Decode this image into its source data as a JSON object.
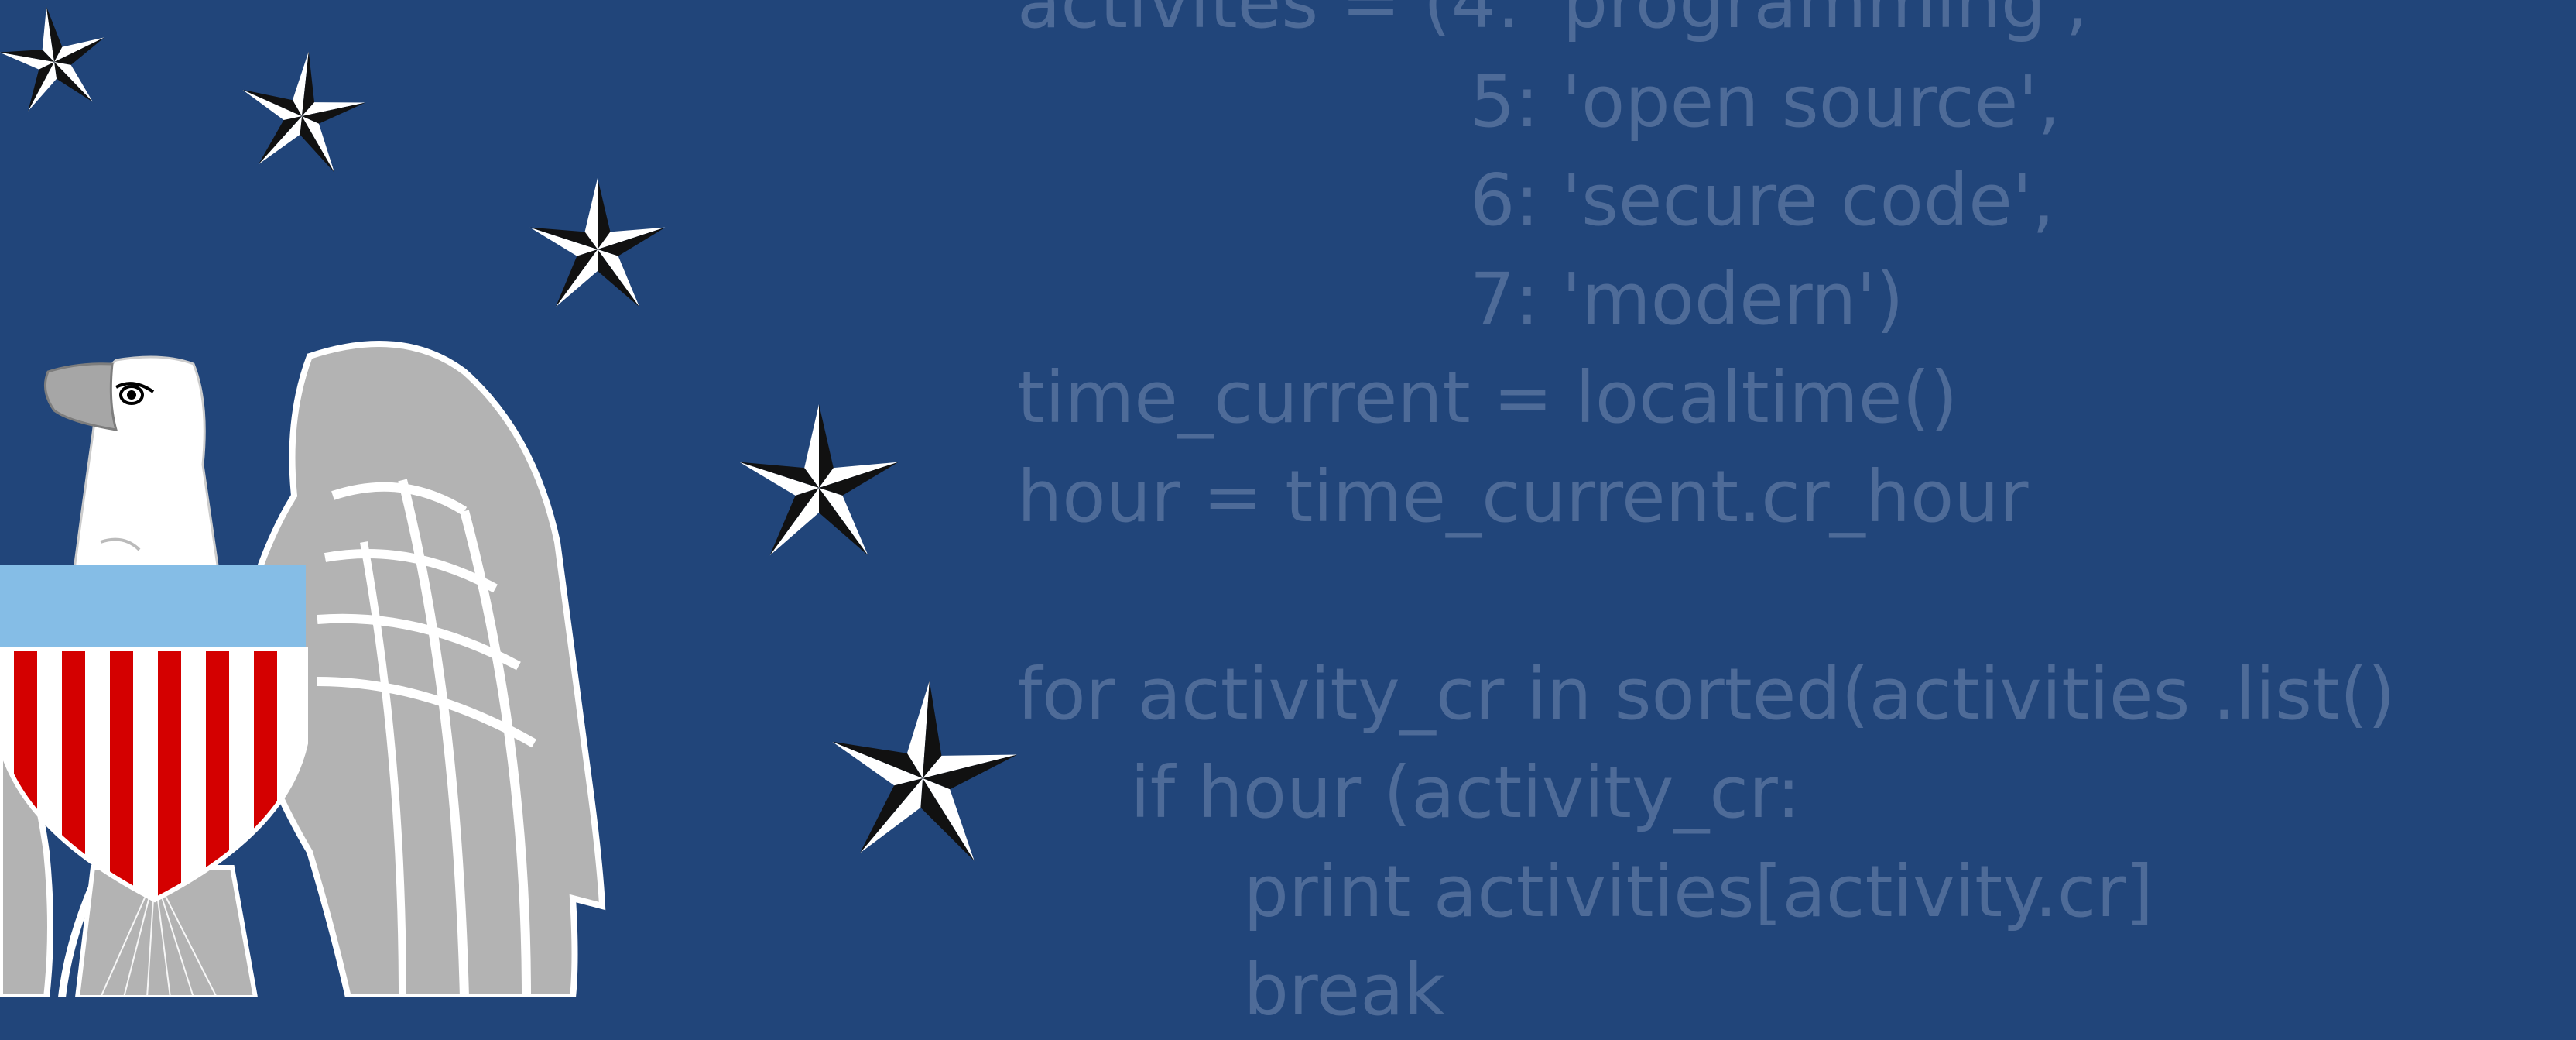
{
  "colors": {
    "background": "#21457a",
    "code_text": "#4e6b98",
    "shield_chief": "#85bde6",
    "stripe_red": "#d40000",
    "stripe_white": "#ffffff",
    "eagle_grey": "#b3b3b3",
    "star_black": "#111111",
    "star_white": "#ffffff"
  },
  "decorations": {
    "stars_icon": "five-point-compass-star-icon",
    "eagle_icon": "eagle-with-shield-emblem"
  },
  "code": {
    "lines": [
      "activites = (4: 'programming',",
      "                    5: 'open source',",
      "                    6: 'secure code',",
      "                    7: 'modern')",
      "time_current = localtime()",
      "hour = time_current.cr_hour",
      "",
      "for activity_cr in sorted(activities .list()",
      "     if hour (activity_cr:",
      "          print activities[activity.cr]",
      "          break"
    ]
  }
}
